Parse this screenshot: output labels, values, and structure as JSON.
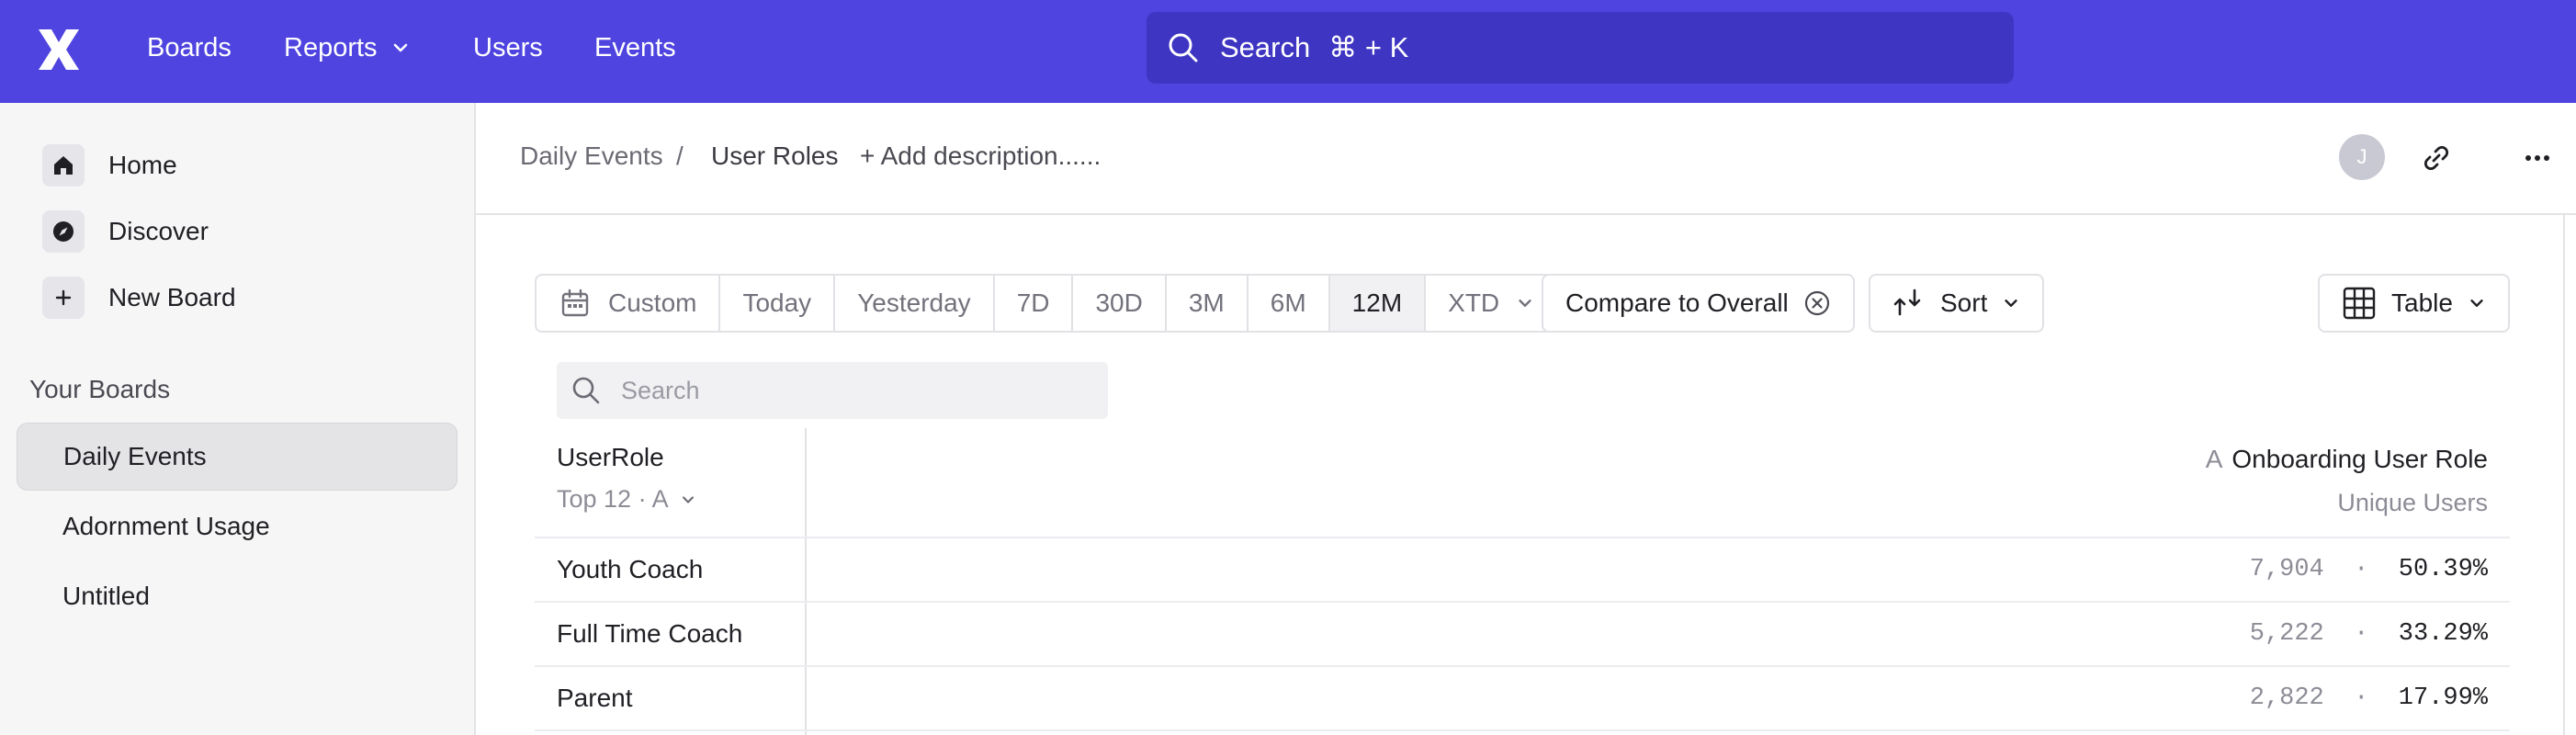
{
  "topnav": {
    "items": [
      {
        "label": "Boards"
      },
      {
        "label": "Reports"
      },
      {
        "label": "Users"
      },
      {
        "label": "Events"
      }
    ],
    "search_label": "Search",
    "search_shortcut": "⌘ + K"
  },
  "sidebar": {
    "items": [
      {
        "label": "Home",
        "icon": "home-icon"
      },
      {
        "label": "Discover",
        "icon": "compass-icon"
      },
      {
        "label": "New Board",
        "icon": "plus-icon"
      }
    ],
    "section_title": "Your Boards",
    "boards": [
      {
        "label": "Daily Events",
        "active": true
      },
      {
        "label": "Adornment Usage",
        "active": false
      },
      {
        "label": "Untitled",
        "active": false
      }
    ]
  },
  "header": {
    "breadcrumb_parent": "Daily Events",
    "breadcrumb_separator": "/",
    "breadcrumb_current": "User Roles",
    "add_description": "+ Add description......",
    "avatar_initial": "J"
  },
  "toolbar": {
    "ranges": [
      {
        "label": "Custom",
        "icon": "calendar-icon",
        "active": false
      },
      {
        "label": "Today",
        "active": false
      },
      {
        "label": "Yesterday",
        "active": false
      },
      {
        "label": "7D",
        "active": false
      },
      {
        "label": "30D",
        "active": false
      },
      {
        "label": "3M",
        "active": false
      },
      {
        "label": "6M",
        "active": false
      },
      {
        "label": "12M",
        "active": true
      },
      {
        "label": "XTD",
        "active": false
      }
    ],
    "compare_label": "Compare to Overall",
    "sort_label": "Sort",
    "view_label": "Table"
  },
  "table": {
    "search_placeholder": "Search",
    "col1_header": "UserRole",
    "col1_sub": "Top 12 · A",
    "col2_prefix": "A",
    "col2_header": "Onboarding User Role",
    "col2_sub": "Unique Users",
    "rows": [
      {
        "label": "Youth Coach",
        "value": "7,904",
        "sep": "·",
        "pct": "50.39%"
      },
      {
        "label": "Full Time Coach",
        "value": "5,222",
        "sep": "·",
        "pct": "33.29%"
      },
      {
        "label": "Parent",
        "value": "2,822",
        "sep": "·",
        "pct": "17.99%"
      }
    ]
  },
  "colors": {
    "topbar": "#4f44e0",
    "search_bg": "#3e35c2",
    "sidebar_bg": "#f6f6f7",
    "active_board_bg": "#e4e4e7"
  }
}
